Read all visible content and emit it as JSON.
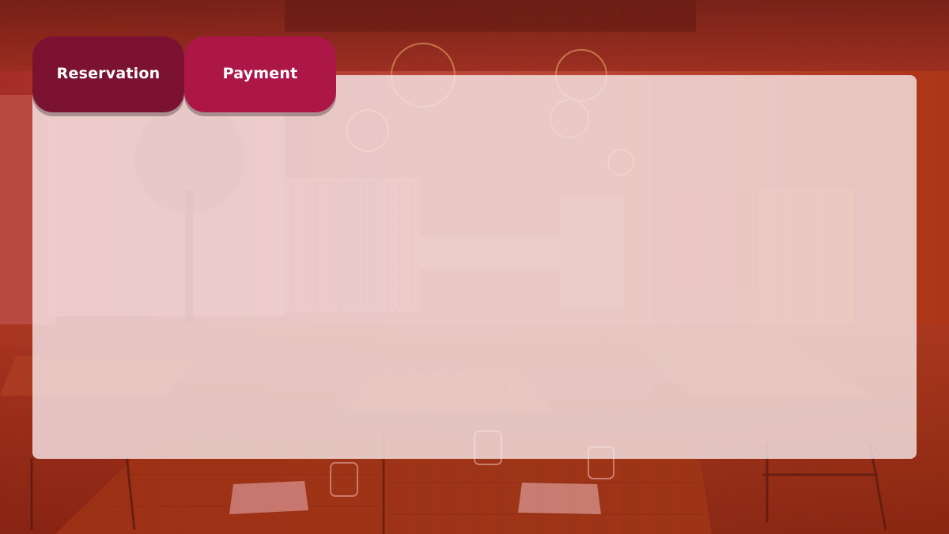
{
  "tabs": {
    "reservation_label": "Reservation",
    "payment_label": "Payment"
  },
  "colors": {
    "reservation_tab": "#7b1232",
    "payment_tab": "#ad1748",
    "panel_overlay": "#f6e8ea",
    "background_tint": "#b2342a"
  },
  "background": {
    "icon": "restaurant-interior-photo"
  }
}
